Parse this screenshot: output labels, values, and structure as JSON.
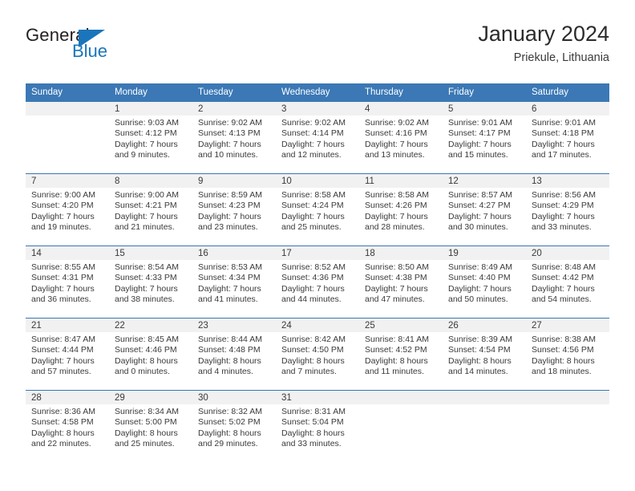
{
  "brand": {
    "name_part1": "General",
    "name_part2": "Blue",
    "triangle_icon": "blue-triangle-logo-mark",
    "accent_color": "#1b75bb"
  },
  "header": {
    "title": "January 2024",
    "subtitle": "Priekule, Lithuania"
  },
  "calendar": {
    "header_bg_color": "#3b78b5",
    "daynum_band_color": "#f1f1f1",
    "weekday_headers": [
      "Sunday",
      "Monday",
      "Tuesday",
      "Wednesday",
      "Thursday",
      "Friday",
      "Saturday"
    ],
    "weeks": [
      [
        {
          "day": "",
          "lines": []
        },
        {
          "day": "1",
          "lines": [
            "Sunrise: 9:03 AM",
            "Sunset: 4:12 PM",
            "Daylight: 7 hours",
            "and 9 minutes."
          ]
        },
        {
          "day": "2",
          "lines": [
            "Sunrise: 9:02 AM",
            "Sunset: 4:13 PM",
            "Daylight: 7 hours",
            "and 10 minutes."
          ]
        },
        {
          "day": "3",
          "lines": [
            "Sunrise: 9:02 AM",
            "Sunset: 4:14 PM",
            "Daylight: 7 hours",
            "and 12 minutes."
          ]
        },
        {
          "day": "4",
          "lines": [
            "Sunrise: 9:02 AM",
            "Sunset: 4:16 PM",
            "Daylight: 7 hours",
            "and 13 minutes."
          ]
        },
        {
          "day": "5",
          "lines": [
            "Sunrise: 9:01 AM",
            "Sunset: 4:17 PM",
            "Daylight: 7 hours",
            "and 15 minutes."
          ]
        },
        {
          "day": "6",
          "lines": [
            "Sunrise: 9:01 AM",
            "Sunset: 4:18 PM",
            "Daylight: 7 hours",
            "and 17 minutes."
          ]
        }
      ],
      [
        {
          "day": "7",
          "lines": [
            "Sunrise: 9:00 AM",
            "Sunset: 4:20 PM",
            "Daylight: 7 hours",
            "and 19 minutes."
          ]
        },
        {
          "day": "8",
          "lines": [
            "Sunrise: 9:00 AM",
            "Sunset: 4:21 PM",
            "Daylight: 7 hours",
            "and 21 minutes."
          ]
        },
        {
          "day": "9",
          "lines": [
            "Sunrise: 8:59 AM",
            "Sunset: 4:23 PM",
            "Daylight: 7 hours",
            "and 23 minutes."
          ]
        },
        {
          "day": "10",
          "lines": [
            "Sunrise: 8:58 AM",
            "Sunset: 4:24 PM",
            "Daylight: 7 hours",
            "and 25 minutes."
          ]
        },
        {
          "day": "11",
          "lines": [
            "Sunrise: 8:58 AM",
            "Sunset: 4:26 PM",
            "Daylight: 7 hours",
            "and 28 minutes."
          ]
        },
        {
          "day": "12",
          "lines": [
            "Sunrise: 8:57 AM",
            "Sunset: 4:27 PM",
            "Daylight: 7 hours",
            "and 30 minutes."
          ]
        },
        {
          "day": "13",
          "lines": [
            "Sunrise: 8:56 AM",
            "Sunset: 4:29 PM",
            "Daylight: 7 hours",
            "and 33 minutes."
          ]
        }
      ],
      [
        {
          "day": "14",
          "lines": [
            "Sunrise: 8:55 AM",
            "Sunset: 4:31 PM",
            "Daylight: 7 hours",
            "and 36 minutes."
          ]
        },
        {
          "day": "15",
          "lines": [
            "Sunrise: 8:54 AM",
            "Sunset: 4:33 PM",
            "Daylight: 7 hours",
            "and 38 minutes."
          ]
        },
        {
          "day": "16",
          "lines": [
            "Sunrise: 8:53 AM",
            "Sunset: 4:34 PM",
            "Daylight: 7 hours",
            "and 41 minutes."
          ]
        },
        {
          "day": "17",
          "lines": [
            "Sunrise: 8:52 AM",
            "Sunset: 4:36 PM",
            "Daylight: 7 hours",
            "and 44 minutes."
          ]
        },
        {
          "day": "18",
          "lines": [
            "Sunrise: 8:50 AM",
            "Sunset: 4:38 PM",
            "Daylight: 7 hours",
            "and 47 minutes."
          ]
        },
        {
          "day": "19",
          "lines": [
            "Sunrise: 8:49 AM",
            "Sunset: 4:40 PM",
            "Daylight: 7 hours",
            "and 50 minutes."
          ]
        },
        {
          "day": "20",
          "lines": [
            "Sunrise: 8:48 AM",
            "Sunset: 4:42 PM",
            "Daylight: 7 hours",
            "and 54 minutes."
          ]
        }
      ],
      [
        {
          "day": "21",
          "lines": [
            "Sunrise: 8:47 AM",
            "Sunset: 4:44 PM",
            "Daylight: 7 hours",
            "and 57 minutes."
          ]
        },
        {
          "day": "22",
          "lines": [
            "Sunrise: 8:45 AM",
            "Sunset: 4:46 PM",
            "Daylight: 8 hours",
            "and 0 minutes."
          ]
        },
        {
          "day": "23",
          "lines": [
            "Sunrise: 8:44 AM",
            "Sunset: 4:48 PM",
            "Daylight: 8 hours",
            "and 4 minutes."
          ]
        },
        {
          "day": "24",
          "lines": [
            "Sunrise: 8:42 AM",
            "Sunset: 4:50 PM",
            "Daylight: 8 hours",
            "and 7 minutes."
          ]
        },
        {
          "day": "25",
          "lines": [
            "Sunrise: 8:41 AM",
            "Sunset: 4:52 PM",
            "Daylight: 8 hours",
            "and 11 minutes."
          ]
        },
        {
          "day": "26",
          "lines": [
            "Sunrise: 8:39 AM",
            "Sunset: 4:54 PM",
            "Daylight: 8 hours",
            "and 14 minutes."
          ]
        },
        {
          "day": "27",
          "lines": [
            "Sunrise: 8:38 AM",
            "Sunset: 4:56 PM",
            "Daylight: 8 hours",
            "and 18 minutes."
          ]
        }
      ],
      [
        {
          "day": "28",
          "lines": [
            "Sunrise: 8:36 AM",
            "Sunset: 4:58 PM",
            "Daylight: 8 hours",
            "and 22 minutes."
          ]
        },
        {
          "day": "29",
          "lines": [
            "Sunrise: 8:34 AM",
            "Sunset: 5:00 PM",
            "Daylight: 8 hours",
            "and 25 minutes."
          ]
        },
        {
          "day": "30",
          "lines": [
            "Sunrise: 8:32 AM",
            "Sunset: 5:02 PM",
            "Daylight: 8 hours",
            "and 29 minutes."
          ]
        },
        {
          "day": "31",
          "lines": [
            "Sunrise: 8:31 AM",
            "Sunset: 5:04 PM",
            "Daylight: 8 hours",
            "and 33 minutes."
          ]
        },
        {
          "day": "",
          "lines": []
        },
        {
          "day": "",
          "lines": []
        },
        {
          "day": "",
          "lines": []
        }
      ]
    ]
  }
}
